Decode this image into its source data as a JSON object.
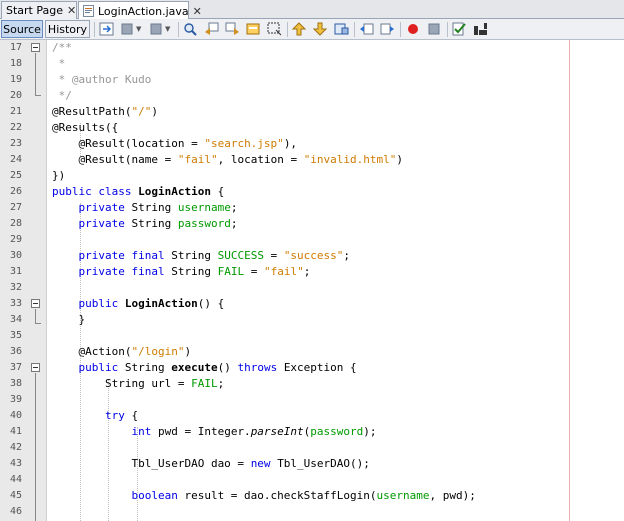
{
  "tabs": [
    {
      "label": "Start Page",
      "close": "✕"
    },
    {
      "label": "LoginAction.java",
      "close": "✕"
    }
  ],
  "toolbar": {
    "source_label": "Source",
    "history_label": "History"
  },
  "gutter": [
    "17",
    "18",
    "19",
    "20",
    "21",
    "22",
    "23",
    "24",
    "25",
    "26",
    "27",
    "28",
    "29",
    "30",
    "31",
    "32",
    "33",
    "34",
    "35",
    "36",
    "37",
    "38",
    "39",
    "40",
    "41",
    "42",
    "43",
    "44",
    "45",
    "46"
  ],
  "code": {
    "l17": {
      "a": "/**"
    },
    "l18": {
      "a": " *"
    },
    "l19": {
      "a": " * @author Kudo"
    },
    "l20": {
      "a": " */"
    },
    "l21": {
      "a": "@ResultPath(",
      "b": "\"/\"",
      "c": ")"
    },
    "l22": {
      "a": "@Results({"
    },
    "l23": {
      "a": "    @Result(location = ",
      "b": "\"search.jsp\"",
      "c": "),"
    },
    "l24": {
      "a": "    @Result(name = ",
      "b": "\"fail\"",
      "c": ", location = ",
      "d": "\"invalid.html\"",
      "e": ")"
    },
    "l25": {
      "a": "})"
    },
    "l26": {
      "a": "public class ",
      "b": "LoginAction",
      "c": " {"
    },
    "l27": {
      "a": "    private ",
      "b": "String ",
      "c": "username",
      "d": ";"
    },
    "l28": {
      "a": "    private ",
      "b": "String ",
      "c": "password",
      "d": ";"
    },
    "l30": {
      "a": "    private final ",
      "b": "String ",
      "c": "SUCCESS",
      "d": " = ",
      "e": "\"success\"",
      "f": ";"
    },
    "l31": {
      "a": "    private final ",
      "b": "String ",
      "c": "FAIL",
      "d": " = ",
      "e": "\"fail\"",
      "f": ";"
    },
    "l33": {
      "a": "    public ",
      "b": "LoginAction",
      "c": "() {"
    },
    "l34": {
      "a": "    }"
    },
    "l36": {
      "a": "    @Action(",
      "b": "\"/login\"",
      "c": ")"
    },
    "l37": {
      "a": "    public ",
      "b": "String ",
      "c": "execute",
      "d": "() ",
      "e": "throws ",
      "f": "Exception {"
    },
    "l38": {
      "a": "        String url = ",
      "b": "FAIL",
      "c": ";"
    },
    "l40": {
      "a": "        try",
      "b": " {"
    },
    "l41": {
      "a": "            int ",
      "b": "pwd = Integer.",
      "c": "parseInt",
      "d": "(",
      "e": "password",
      "f": ");"
    },
    "l43": {
      "a": "            Tbl_UserDAO dao = ",
      "b": "new ",
      "c": "Tbl_UserDAO();"
    },
    "l45": {
      "a": "            boolean ",
      "b": "result = dao.checkStaffLogin(",
      "c": "username",
      "d": ", pwd);"
    }
  }
}
